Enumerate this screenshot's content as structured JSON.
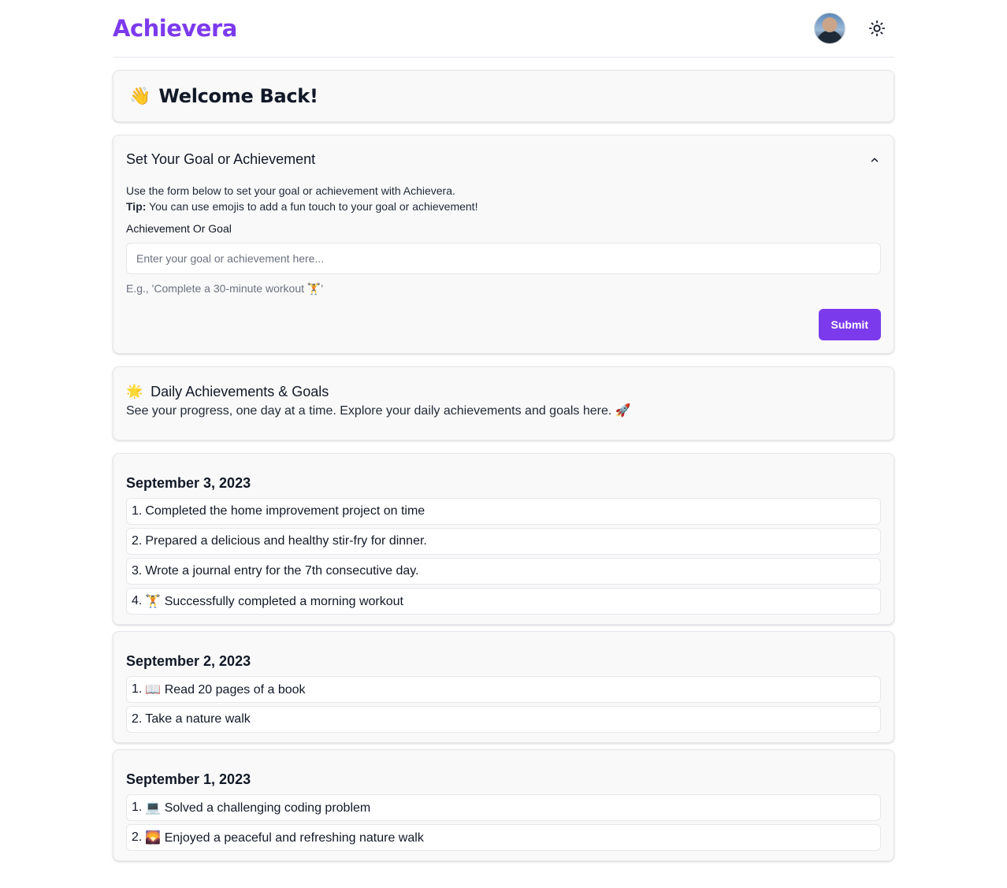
{
  "app": {
    "name": "Achievera",
    "brand_color": "#7c3aed"
  },
  "header": {
    "avatar_alt": "User avatar",
    "theme_icon": "sun-icon"
  },
  "welcome": {
    "emoji": "👋",
    "title": "Welcome Back!"
  },
  "goal_form": {
    "title": "Set Your Goal or Achievement",
    "collapse_icon": "chevron-up-icon",
    "description": "Use the form below to set your goal or achievement with Achievera.",
    "tip_label": "Tip:",
    "tip_text": " You can use emojis to add a fun touch to your goal or achievement!",
    "field_label": "Achievement Or Goal",
    "input_value": "",
    "input_placeholder": "Enter your goal or achievement here...",
    "helper": "E.g., 'Complete a 30-minute workout 🏋️'",
    "submit_label": "Submit"
  },
  "daily": {
    "emoji": "🌟",
    "title": "Daily Achievements & Goals",
    "subtitle": "See your progress, one day at a time. Explore your daily achievements and goals here. 🚀"
  },
  "days": [
    {
      "date": "September 3, 2023",
      "items": [
        {
          "num": "1.",
          "text": "Completed the home improvement project on time"
        },
        {
          "num": "2.",
          "text": "Prepared a delicious and healthy stir-fry for dinner."
        },
        {
          "num": "3.",
          "text": "Wrote a journal entry for the 7th consecutive day."
        },
        {
          "num": "4.",
          "text": "🏋️ Successfully completed a morning workout"
        }
      ]
    },
    {
      "date": "September 2, 2023",
      "items": [
        {
          "num": "1.",
          "text": "📖 Read 20 pages of a book"
        },
        {
          "num": "2.",
          "text": "Take a nature walk"
        }
      ]
    },
    {
      "date": "September 1, 2023",
      "items": [
        {
          "num": "1.",
          "text": "💻 Solved a challenging coding problem"
        },
        {
          "num": "2.",
          "text": "🌄 Enjoyed a peaceful and refreshing nature walk"
        }
      ]
    }
  ]
}
